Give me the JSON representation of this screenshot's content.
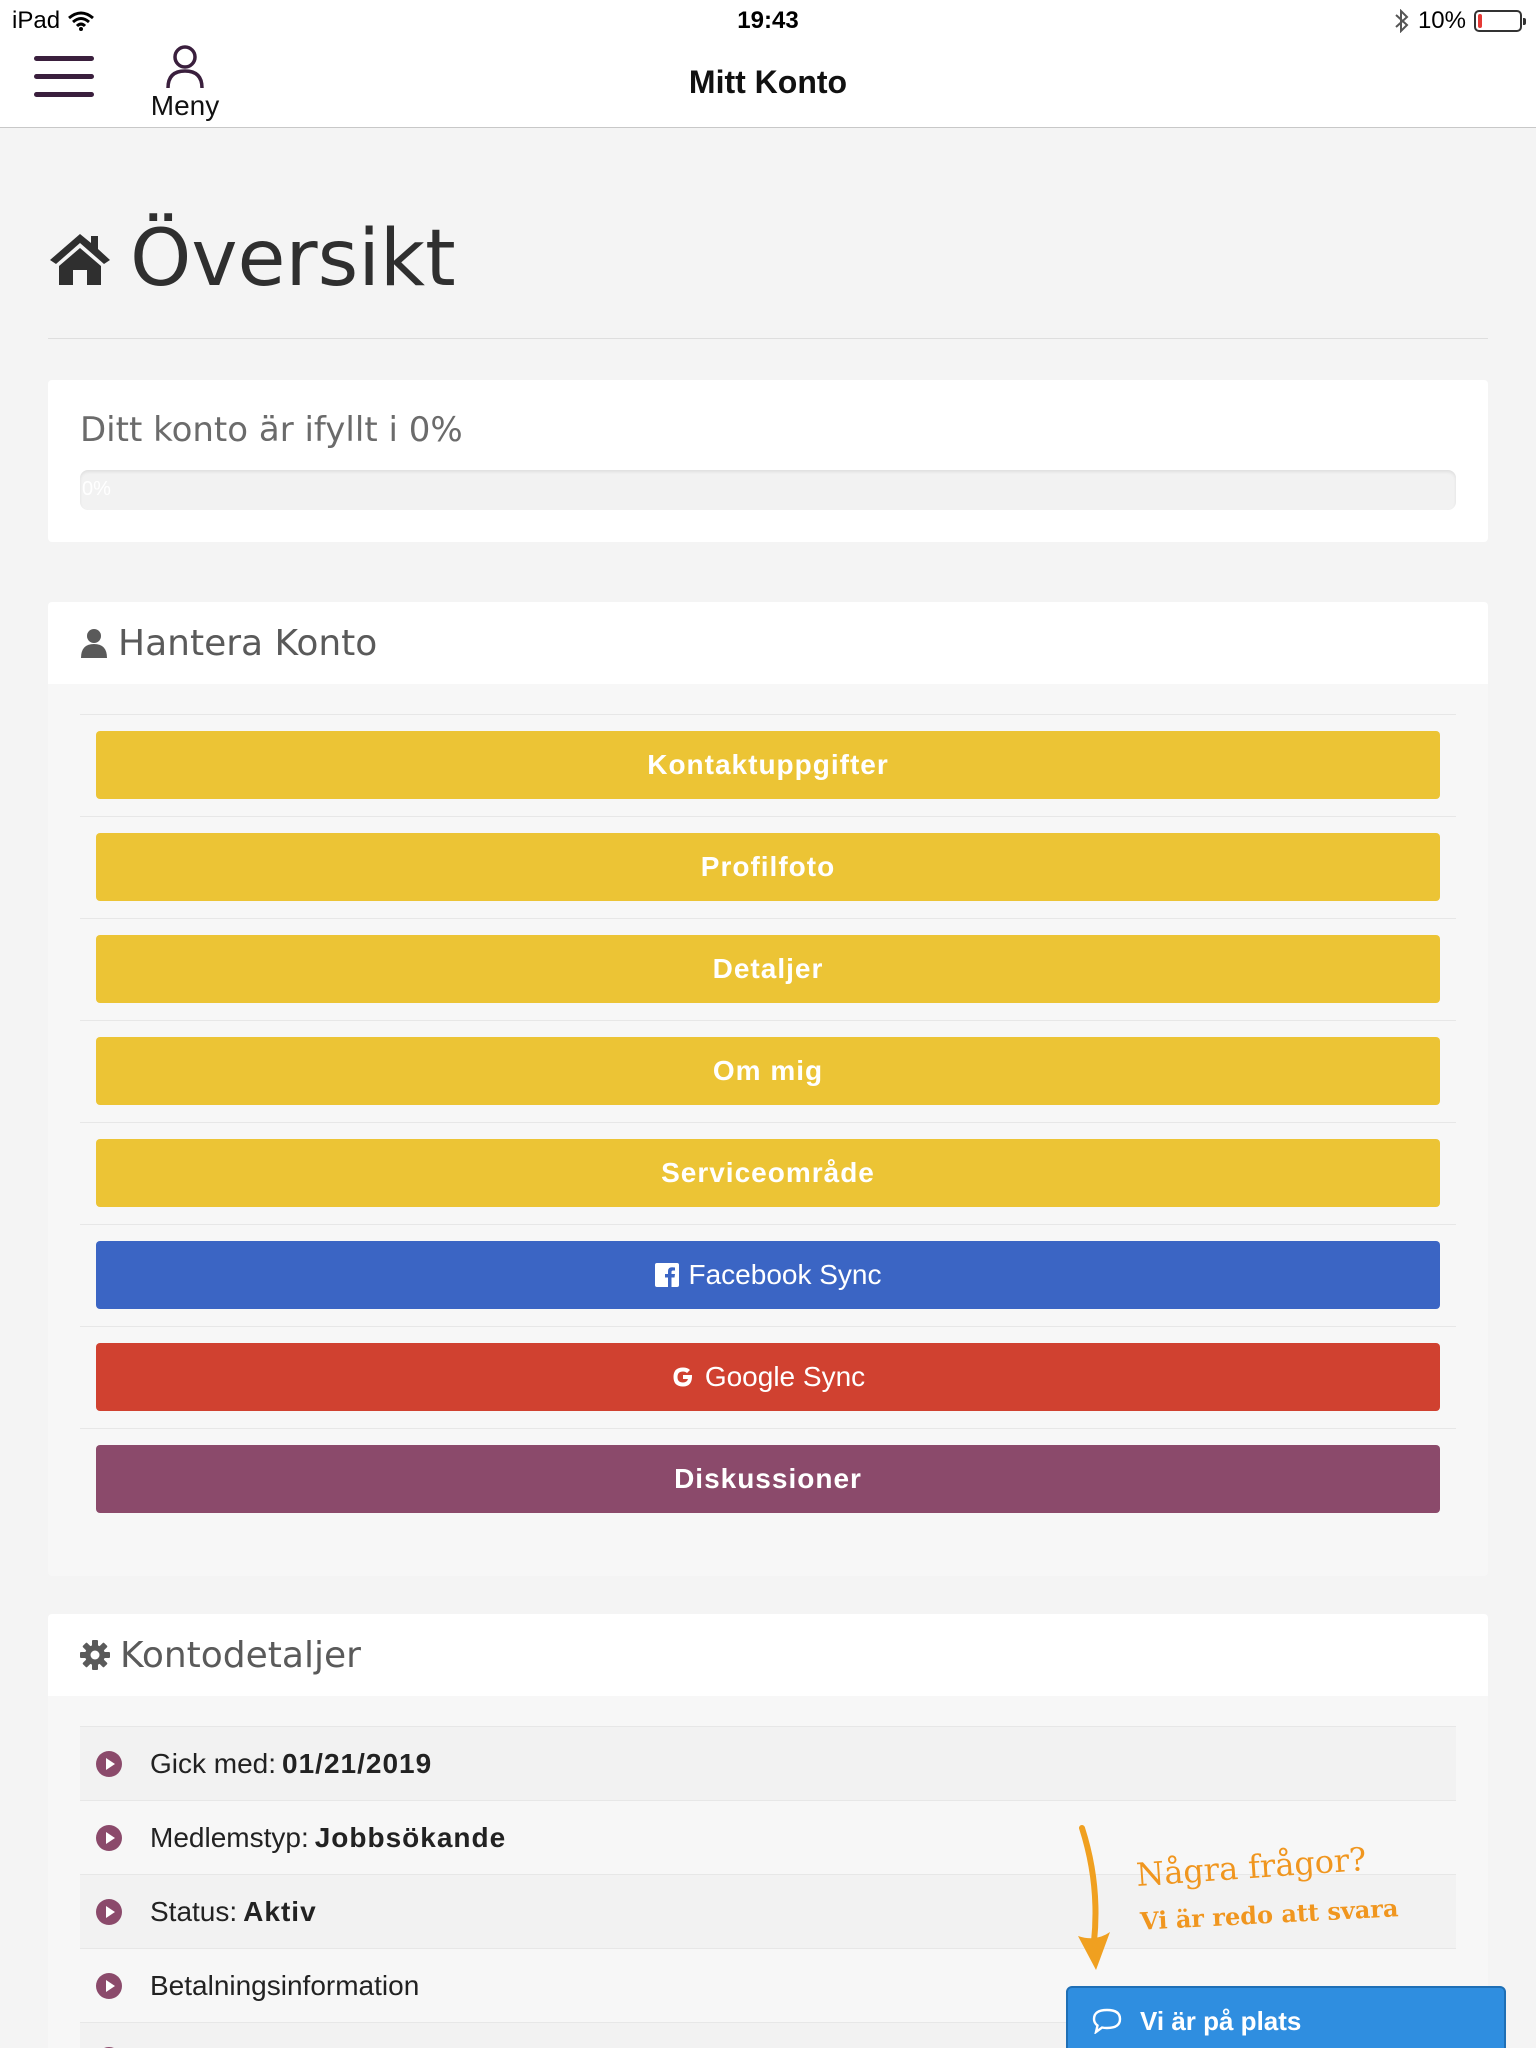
{
  "status_bar": {
    "device": "iPad",
    "time": "19:43",
    "battery": "10%",
    "battery_level": 0.1
  },
  "nav": {
    "menu_label": "Meny",
    "title": "Mitt Konto"
  },
  "page": {
    "title": "Översikt"
  },
  "progress": {
    "label": "Ditt konto är ifyllt i 0%",
    "bar_text": "0%",
    "percent": 0
  },
  "manage": {
    "heading": "Hantera Konto",
    "buttons": [
      {
        "label": "Kontaktuppgifter",
        "color": "#ecc435"
      },
      {
        "label": "Profilfoto",
        "color": "#ecc435"
      },
      {
        "label": "Detaljer",
        "color": "#ecc435"
      },
      {
        "label": "Om mig",
        "color": "#ecc435"
      },
      {
        "label": "Serviceområde",
        "color": "#ecc435"
      },
      {
        "label": "Facebook Sync",
        "color": "#3b65c4",
        "icon": "facebook-icon"
      },
      {
        "label": "Google Sync",
        "color": "#d04130",
        "icon": "google-icon"
      },
      {
        "label": "Diskussioner",
        "color": "#8b4a6b"
      }
    ]
  },
  "details": {
    "heading": "Kontodetaljer",
    "rows": [
      {
        "label": "Gick med:",
        "value": "01/21/2019"
      },
      {
        "label": "Medlemstyp:",
        "value": "Jobbsökande"
      },
      {
        "label": "Status:",
        "value": "Aktiv"
      },
      {
        "label": "Betalningsinformation",
        "value": ""
      }
    ]
  },
  "chat": {
    "question": "Några frågor?",
    "subtext": "Vi är redo att svara",
    "button_label": "Vi är på plats"
  },
  "colors": {
    "accent": "#8b4a6b",
    "yellow": "#ecc435",
    "facebook": "#3b65c4",
    "google": "#d04130",
    "chat": "#2f8ee0",
    "callout": "#f0961f"
  }
}
